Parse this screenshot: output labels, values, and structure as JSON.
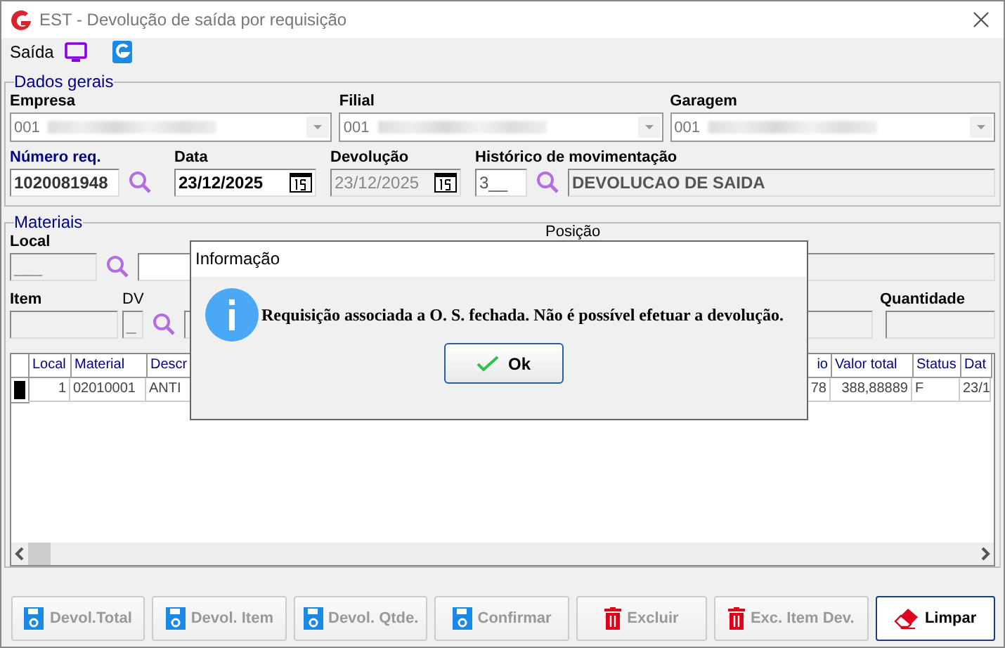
{
  "window": {
    "title": "EST -  Devolução de saída por requisição"
  },
  "toolbar": {
    "label": "Saída"
  },
  "dados_gerais": {
    "title": "Dados gerais",
    "combos": [
      {
        "label": "Empresa",
        "value": "001"
      },
      {
        "label": "Filial",
        "value": "001"
      },
      {
        "label": "Garagem",
        "value": "001"
      }
    ],
    "numero_req": {
      "label": "Número req.",
      "value": "1020081948"
    },
    "dates": [
      {
        "label": "Data",
        "value": "23/12/2025",
        "disabled": false
      },
      {
        "label": "Devolução",
        "value": "23/12/2025",
        "disabled": true
      }
    ],
    "historico": {
      "label": "Histórico de movimentação",
      "code": "3__",
      "description": "DEVOLUCAO DE SAIDA"
    }
  },
  "materiais": {
    "title": "Materiais",
    "local": {
      "label": "Local",
      "value": "___"
    },
    "posicao_label": "Posição",
    "item_label": "Item",
    "dv": {
      "label": "DV",
      "value": "_"
    },
    "quantidade_label": "Quantidade"
  },
  "table": {
    "columns": [
      "Local",
      "Material",
      "Descr",
      "io",
      "Valor total",
      "Status",
      "Dat"
    ],
    "rows": [
      {
        "cells": [
          "1",
          "02010001",
          "ANTI",
          "78",
          "388,88889",
          "F",
          "23/1"
        ],
        "selected": true
      }
    ]
  },
  "buttons": [
    {
      "label": "Devol.Total",
      "kind": "save",
      "disabled": true
    },
    {
      "label": "Devol. Item",
      "kind": "save",
      "disabled": true
    },
    {
      "label": "Devol. Qtde.",
      "kind": "save",
      "disabled": true
    },
    {
      "label": "Confirmar",
      "kind": "save",
      "disabled": true
    },
    {
      "label": "Excluir",
      "kind": "trash",
      "disabled": true
    },
    {
      "label": "Exc. Item Dev.",
      "kind": "trash",
      "disabled": true
    },
    {
      "label": "Limpar",
      "kind": "eraser",
      "disabled": false
    }
  ],
  "dialog": {
    "title": "Informação",
    "message": "Requisição associada a O. S. fechada. Não é possível efetuar a devolução.",
    "button": "Ok"
  }
}
